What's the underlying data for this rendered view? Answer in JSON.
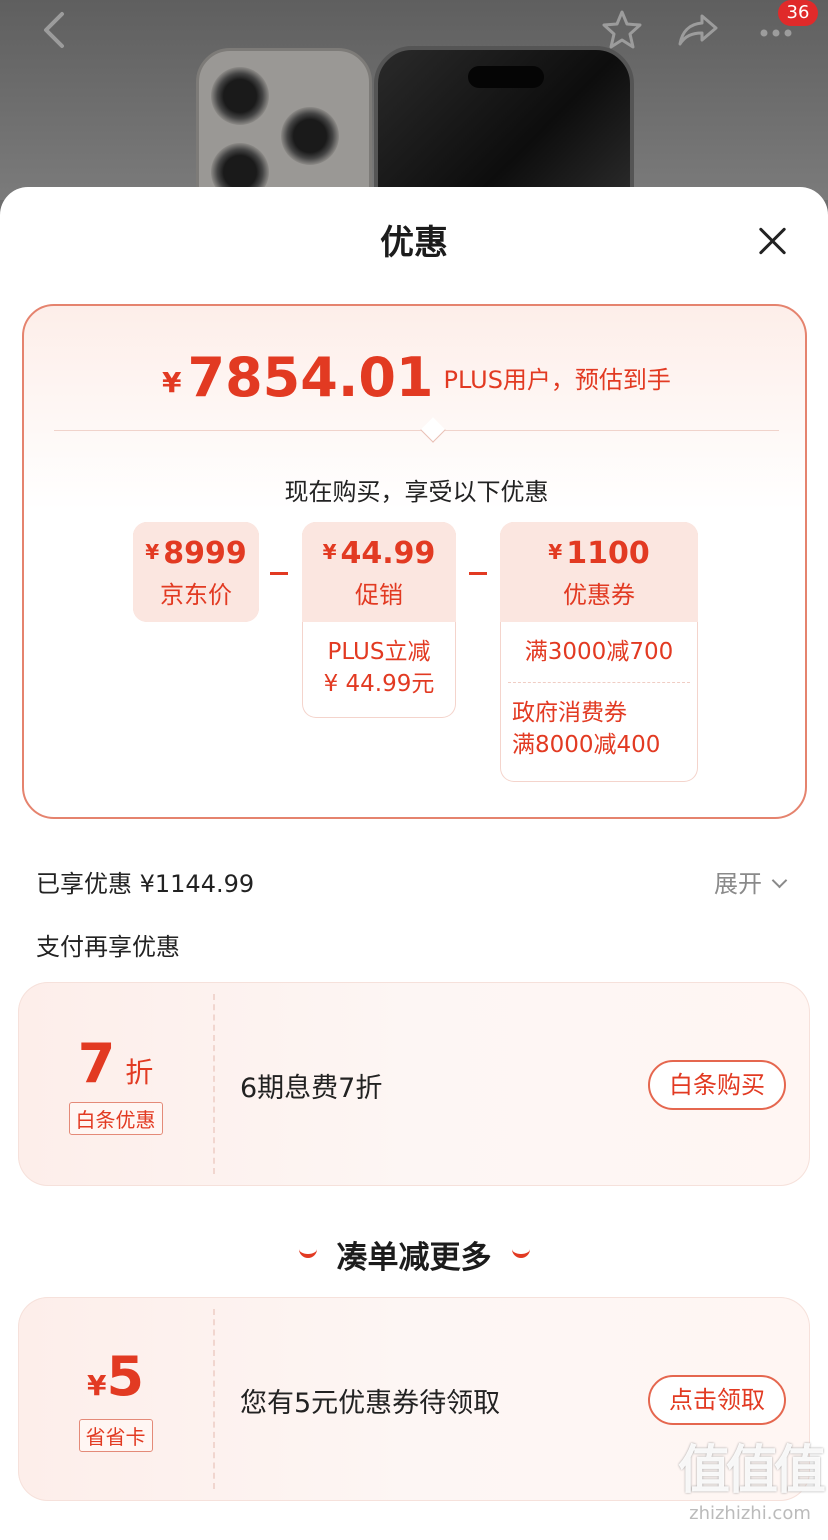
{
  "header": {
    "back_icon": "chevron-left-icon",
    "favorite_icon": "star-icon",
    "share_icon": "share-arrow-icon",
    "more_icon": "more-dots-icon",
    "badge_count": "36"
  },
  "sheet": {
    "title": "优惠"
  },
  "price": {
    "currency": "¥",
    "amount": "7854.01",
    "suffix": "PLUS用户，预估到手",
    "subtitle": "现在购买，享受以下优惠"
  },
  "breakdown": {
    "jd": {
      "currency": "¥",
      "amount": "8999",
      "label": "京东价"
    },
    "promo": {
      "currency": "¥",
      "amount": "44.99",
      "label": "促销",
      "detail_line1": "PLUS立减",
      "detail_line2": "¥ 44.99元"
    },
    "coupon": {
      "currency": "¥",
      "amount": "1100",
      "label": "优惠券",
      "detail_1": "满3000减700",
      "detail_2_line1": "政府消费券",
      "detail_2_line2": "满8000减400"
    }
  },
  "enjoyed": {
    "text": "已享优惠 ¥1144.99",
    "expand_label": "展开"
  },
  "payment": {
    "title": "支付再享优惠",
    "card": {
      "big_num": "7",
      "big_unit": "折",
      "tag": "白条优惠",
      "desc": "6期息费7折",
      "button": "白条购买"
    }
  },
  "more": {
    "title": "凑单减更多",
    "card": {
      "currency": "¥",
      "big_num": "5",
      "tag": "省省卡",
      "desc": "您有5元优惠券待领取",
      "button": "点击领取"
    }
  },
  "watermark": {
    "logo": "值值值",
    "url": "zhizhizhi.com"
  },
  "colors": {
    "accent": "#e23a22",
    "card_border": "#e5836e",
    "badge": "#e02a2a"
  }
}
